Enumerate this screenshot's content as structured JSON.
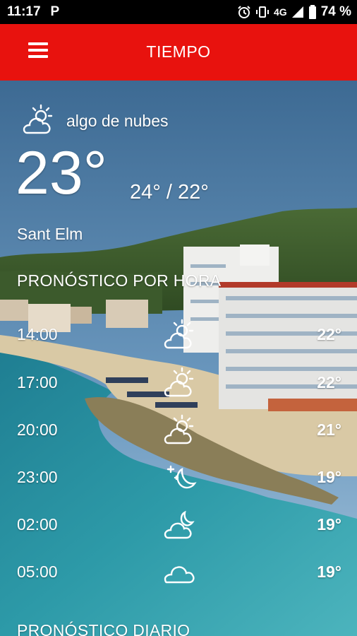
{
  "status_bar": {
    "time": "11:17",
    "app_indicator": "P",
    "network": "4G",
    "battery": "74 %"
  },
  "app_bar": {
    "title": "TIEMPO"
  },
  "current": {
    "condition": "algo de nubes",
    "condition_icon": "partly-cloudy-icon",
    "temperature": "23°",
    "min_max": "24° / 22°",
    "location": "Sant Elm"
  },
  "hourly": {
    "title": "PRONÓSTICO POR HORA",
    "items": [
      {
        "time": "14:00",
        "icon": "partly-cloudy-day-icon",
        "temp": "22°"
      },
      {
        "time": "17:00",
        "icon": "partly-cloudy-day-icon",
        "temp": "22°"
      },
      {
        "time": "20:00",
        "icon": "partly-cloudy-day-icon",
        "temp": "21°"
      },
      {
        "time": "23:00",
        "icon": "clear-night-icon",
        "temp": "19°"
      },
      {
        "time": "02:00",
        "icon": "partly-cloudy-night-icon",
        "temp": "19°"
      },
      {
        "time": "05:00",
        "icon": "cloud-icon",
        "temp": "19°"
      }
    ]
  },
  "daily": {
    "title": "PRONÓSTICO DIARIO"
  },
  "colors": {
    "app_bar": "#e8120e",
    "status_bar": "#000000",
    "text": "#ffffff"
  }
}
